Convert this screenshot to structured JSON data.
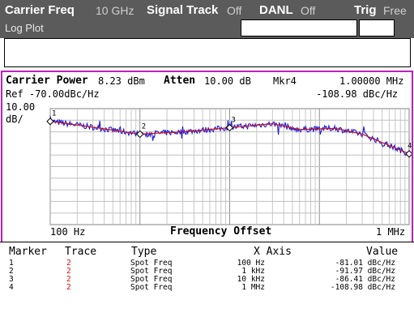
{
  "header": {
    "carrier_freq_label": "Carrier Freq",
    "carrier_freq_value": "10 GHz",
    "signal_track_label": "Signal Track",
    "signal_track_value": "Off",
    "danl_label": "DANL",
    "danl_value": "Off",
    "trig_label": "Trig",
    "trig_value": "Free",
    "mode_label": "Log Plot"
  },
  "graph": {
    "carrier_power_label": "Carrier Power",
    "carrier_power_value": "8.23 dBm",
    "atten_label": "Atten",
    "atten_value": "10.00 dB",
    "marker_label": "Mkr4",
    "marker_freq": "1.00000 MHz",
    "ref_text": "Ref -70.00dBc/Hz",
    "marker_value": "-108.98 dBc/Hz",
    "scale_value": "10.00",
    "scale_unit": "dB/",
    "x_start": "100 Hz",
    "x_title": "Frequency Offset",
    "x_stop": "1 MHz",
    "marker_flags": [
      "1",
      "2",
      "3",
      "4"
    ]
  },
  "table": {
    "headers": [
      "Marker",
      "Trace",
      "Type",
      "X Axis",
      "Value"
    ],
    "rows": [
      {
        "marker": "1",
        "trace": "2",
        "type": "Spot Freq",
        "x": "100 Hz",
        "value": "-81.01 dBc/Hz"
      },
      {
        "marker": "2",
        "trace": "2",
        "type": "Spot Freq",
        "x": "1 kHz",
        "value": "-91.97 dBc/Hz"
      },
      {
        "marker": "3",
        "trace": "2",
        "type": "Spot Freq",
        "x": "10 kHz",
        "value": "-86.41 dBc/Hz"
      },
      {
        "marker": "4",
        "trace": "2",
        "type": "Spot Freq",
        "x": "1 MHz",
        "value": "-108.98 dBc/Hz"
      }
    ]
  },
  "colors": {
    "trace_raw": "#1a1adf",
    "trace_smoothed": "#d01010",
    "graph_border": "#c020c0",
    "header_bg": "#5b5b5b"
  }
}
